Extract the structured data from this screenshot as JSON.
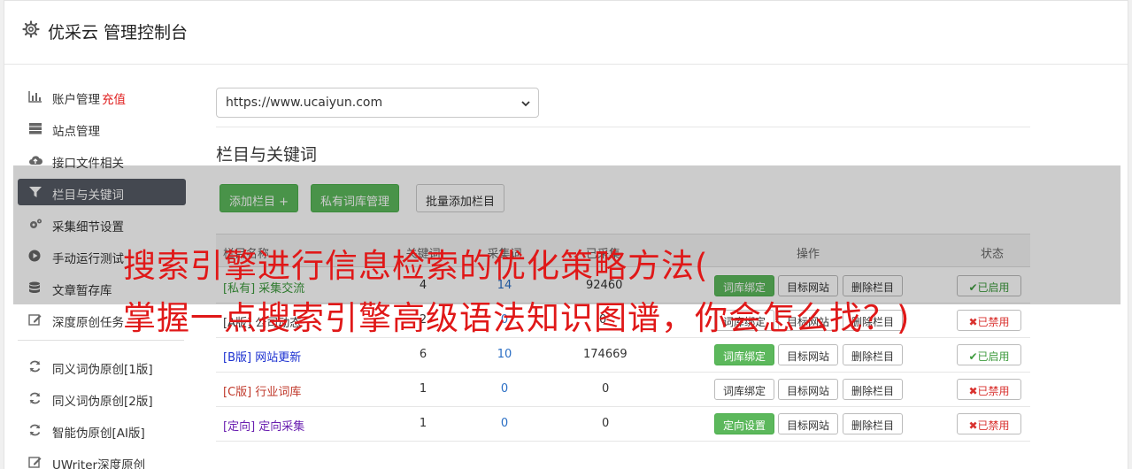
{
  "app": {
    "title": "优采云 管理控制台",
    "gear_icon": "gear-icon"
  },
  "sidebar": {
    "items": [
      {
        "label": "账户管理",
        "extra": "充值",
        "icon": "bar-chart-icon"
      },
      {
        "label": "站点管理",
        "icon": "server-icon"
      },
      {
        "label": "接口文件相关",
        "icon": "cloud-upload-icon"
      },
      {
        "label": "栏目与关键词",
        "icon": "filter-icon",
        "active": true
      },
      {
        "label": "采集细节设置",
        "icon": "cogs-icon"
      },
      {
        "label": "手动运行测试",
        "icon": "play-circle-icon"
      },
      {
        "label": "文章暂存库",
        "icon": "database-icon"
      },
      {
        "label": "深度原创任务",
        "icon": "edit-icon"
      }
    ],
    "items2": [
      {
        "label": "同义词伪原创[1版]",
        "icon": "refresh-icon"
      },
      {
        "label": "同义词伪原创[2版]",
        "icon": "refresh-icon"
      },
      {
        "label": "智能伪原创[AI版]",
        "icon": "refresh-icon"
      },
      {
        "label": "UWriter深度原创",
        "icon": "edit-icon"
      }
    ]
  },
  "main": {
    "site_select": {
      "value": "https://www.ucaiyun.com"
    },
    "section_title": "栏目与关键词",
    "buttons": {
      "add_column": "添加栏目 +",
      "private_lib": "私有词库管理",
      "batch_add": "批量添加栏目"
    },
    "table": {
      "headers": [
        "栏目名称",
        "关键词",
        "采集词",
        "已采集",
        "操作",
        "状态"
      ],
      "rows": [
        {
          "type": "[私有]",
          "name": "采集交流",
          "c1": "4",
          "c2": "14",
          "c3": "92460",
          "bind_label": "词库绑定",
          "bind_green": true,
          "status": "已启用",
          "on": true,
          "style": "green"
        },
        {
          "type": "[A版]",
          "name": "公司动态",
          "c1": "2",
          "c2": "0",
          "c3": "0",
          "bind_label": "词库绑定",
          "bind_green": false,
          "status": "已禁用",
          "on": false,
          "style": "gray"
        },
        {
          "type": "[B版]",
          "name": "网站更新",
          "c1": "6",
          "c2": "10",
          "c3": "174669",
          "bind_label": "词库绑定",
          "bind_green": true,
          "status": "已启用",
          "on": true,
          "style": "blue"
        },
        {
          "type": "[C版]",
          "name": "行业词库",
          "c1": "1",
          "c2": "0",
          "c3": "0",
          "bind_label": "词库绑定",
          "bind_green": false,
          "status": "已禁用",
          "on": false,
          "style": "red"
        },
        {
          "type": "[定向]",
          "name": "定向采集",
          "c1": "1",
          "c2": "0",
          "c3": "0",
          "bind_label": "定向设置",
          "bind_green": true,
          "status": "已禁用",
          "on": false,
          "style": "purple"
        }
      ],
      "target_label": "目标网站",
      "delete_label": "删除栏目"
    }
  },
  "overlay": {
    "line1": "搜索引擎进行信息检索的优化策略方法(",
    "line2": "掌握一点搜索引擎高级语法知识图谱，你会怎么找？)"
  },
  "colors": {
    "accent_green": "#5cb85c",
    "active_nav": "#555a64",
    "banner_red": "#e01818"
  }
}
